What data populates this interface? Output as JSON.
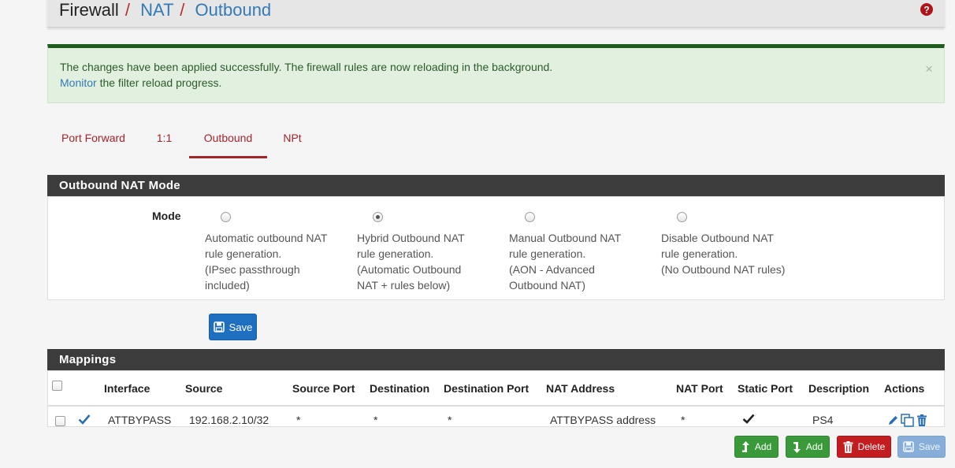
{
  "breadcrumb": {
    "first": "Firewall",
    "second": "NAT",
    "third": "Outbound",
    "sep": "/"
  },
  "alert": {
    "line1": "The changes have been applied successfully. The firewall rules are now reloading in the background.",
    "monitor_link": "Monitor",
    "line2_rest": " the filter reload progress.",
    "close": "×"
  },
  "tabs": [
    {
      "label": "Port Forward",
      "active": false
    },
    {
      "label": "1:1",
      "active": false
    },
    {
      "label": "Outbound",
      "active": true
    },
    {
      "label": "NPt",
      "active": false
    }
  ],
  "mode_panel": {
    "title": "Outbound NAT Mode",
    "label": "Mode",
    "options": [
      {
        "lines": [
          "Automatic outbound NAT",
          "rule generation.",
          "(IPsec passthrough",
          "included)"
        ],
        "checked": false
      },
      {
        "lines": [
          "Hybrid Outbound NAT",
          "rule generation.",
          "(Automatic Outbound",
          "NAT + rules below)"
        ],
        "checked": true
      },
      {
        "lines": [
          "Manual Outbound NAT",
          "rule generation.",
          "(AON - Advanced",
          "Outbound NAT)"
        ],
        "checked": false
      },
      {
        "lines": [
          "Disable Outbound NAT",
          "rule generation.",
          "(No Outbound NAT rules)"
        ],
        "checked": false
      }
    ],
    "save_label": "Save"
  },
  "mappings": {
    "title": "Mappings",
    "columns": [
      "Interface",
      "Source",
      "Source Port",
      "Destination",
      "Destination Port",
      "NAT Address",
      "NAT Port",
      "Static Port",
      "Description",
      "Actions"
    ],
    "rows": [
      {
        "interface": "ATTBYPASS",
        "source": "192.168.2.10/32",
        "source_port": "*",
        "destination": "*",
        "destination_port": "*",
        "nat_address": "ATTBYPASS address",
        "nat_port": "*",
        "static_port": true,
        "description": "PS4"
      }
    ]
  },
  "bottom_buttons": {
    "add_top": "Add",
    "add_bottom": "Add",
    "delete": "Delete",
    "save": "Save"
  },
  "colors": {
    "accent": "#a3242a",
    "primary": "#1f6fc1",
    "success": "#3a9a3a",
    "danger": "#c31d21",
    "panel_head": "#3c3c3c",
    "alert_bg": "#e2f1df"
  }
}
